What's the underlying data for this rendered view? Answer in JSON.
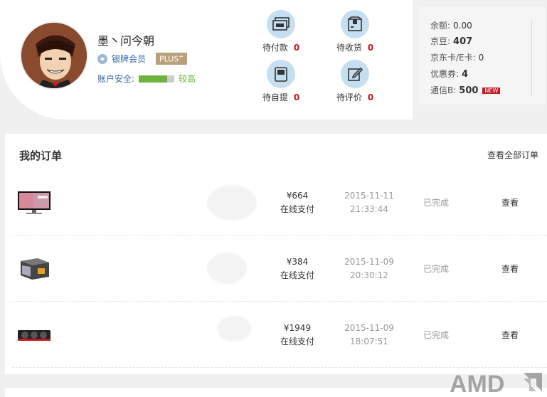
{
  "profile": {
    "username": "墨丶问今朝",
    "member_level": "银牌会员",
    "plus_label": "PLUS",
    "plus_sup": "+",
    "security_label": "账户安全:",
    "security_level": "较高",
    "security_fill": 0.8
  },
  "status": {
    "pending_payment": {
      "label": "待付款",
      "count": "0",
      "icon": "cash-icon"
    },
    "pending_receipt": {
      "label": "待收货",
      "count": "0",
      "icon": "package-icon"
    },
    "pending_pickup": {
      "label": "待自提",
      "count": "0",
      "icon": "pickup-icon"
    },
    "pending_review": {
      "label": "待评价",
      "count": "0",
      "icon": "edit-icon"
    }
  },
  "assets": {
    "balance_label": "余额:",
    "balance_value": "0.00",
    "jingdou_label": "京豆:",
    "jingdou_value": "407",
    "card_label": "京东卡/E卡:",
    "card_value": "0",
    "coupon_label": "优惠券:",
    "coupon_value": "4",
    "tongxin_label": "通信B:",
    "tongxin_value": "500",
    "new_badge": "NEW"
  },
  "orders": {
    "title": "我的订单",
    "view_all": "查看全部订单",
    "rows": [
      {
        "price": "¥664",
        "payment": "在线支付",
        "date": "2015-11-11",
        "time": "21:33:44",
        "status": "已完成",
        "action": "查看"
      },
      {
        "price": "¥384",
        "payment": "在线支付",
        "date": "2015-11-09",
        "time": "20:30:12",
        "status": "已完成",
        "action": "查看"
      },
      {
        "price": "¥1949",
        "payment": "在线支付",
        "date": "2015-11-09",
        "time": "18:07:51",
        "status": "已完成",
        "action": "查看"
      }
    ]
  },
  "watermark": "AMD",
  "colors": {
    "accent_red": "#c81623",
    "link_blue": "#3a6aa8",
    "security_green": "#6cb33e",
    "icon_bg": "#c5dff0"
  }
}
